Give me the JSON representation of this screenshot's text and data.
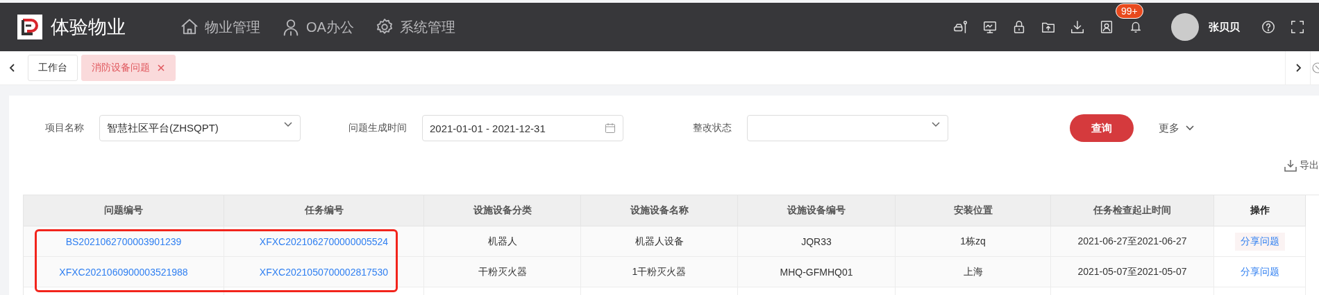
{
  "app": {
    "title": "体验物业"
  },
  "nav": [
    {
      "label": "物业管理",
      "kind": "home"
    },
    {
      "label": "OA办公",
      "kind": "user"
    },
    {
      "label": "系统管理",
      "kind": "gear"
    }
  ],
  "header": {
    "badge": "99+",
    "user": "张贝贝"
  },
  "tabs": [
    {
      "label": "工作台",
      "selected": false
    },
    {
      "label": "消防设备问题",
      "selected": true
    }
  ],
  "filters": [
    {
      "label": "项目名称",
      "kind": "select",
      "value": "智慧社区平台(ZHSQPT)"
    },
    {
      "label": "问题生成时间",
      "kind": "date",
      "value": "2021-01-01 - 2021-12-31"
    },
    {
      "label": "整改状态",
      "kind": "select"
    }
  ],
  "query_button": "查询",
  "more": "更多",
  "export": "导出",
  "table": {
    "columns": [
      "问题编号",
      "任务编号",
      "设施设备分类",
      "设施设备名称",
      "设施设备编号",
      "安装位置",
      "任务检查起止时间",
      "操作"
    ],
    "rows": [
      {
        "cells": [
          "BS2021062700003901239",
          "XFXC2021062700000005524",
          "机器人",
          "机器人设备",
          "JQR33",
          "1栋zq",
          "2021-06-27至2021-06-27"
        ],
        "action": "分享问题"
      },
      {
        "cells": [
          "XFXC2021060900003521988",
          "XFXC2021050700002817530",
          "干粉灭火器",
          "1干粉灭火器",
          "MHQ-GFMHQ01",
          "上海",
          "2021-05-07至2021-05-07"
        ],
        "action": "分享问题"
      }
    ]
  }
}
